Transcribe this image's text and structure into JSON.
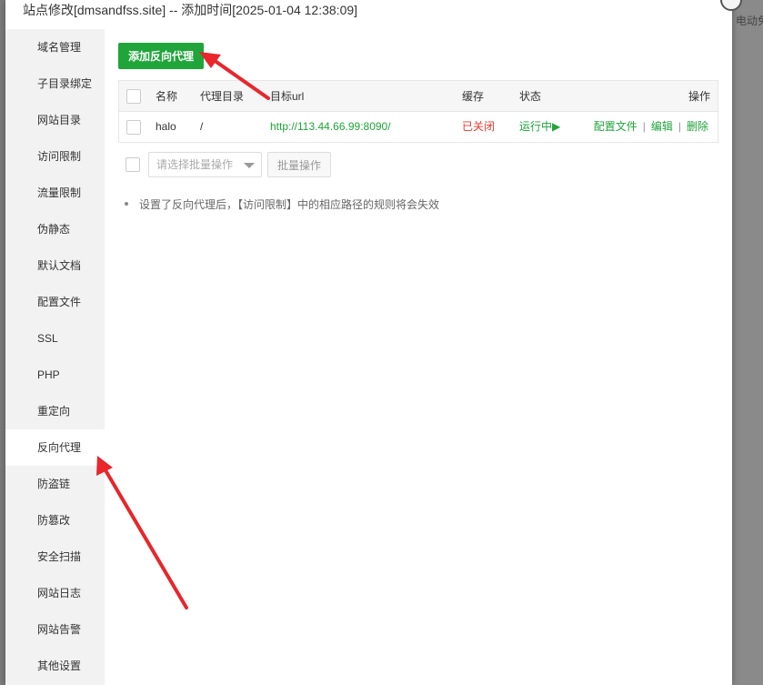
{
  "window": {
    "title": "站点修改[dmsandfss.site] -- 添加时间[2025-01-04 12:38:09]"
  },
  "background": {
    "right_label": "电动免"
  },
  "sidebar": {
    "items": [
      {
        "label": "域名管理"
      },
      {
        "label": "子目录绑定"
      },
      {
        "label": "网站目录"
      },
      {
        "label": "访问限制"
      },
      {
        "label": "流量限制"
      },
      {
        "label": "伪静态"
      },
      {
        "label": "默认文档"
      },
      {
        "label": "配置文件"
      },
      {
        "label": "SSL"
      },
      {
        "label": "PHP"
      },
      {
        "label": "重定向"
      },
      {
        "label": "反向代理",
        "active": true
      },
      {
        "label": "防盗链"
      },
      {
        "label": "防篡改"
      },
      {
        "label": "安全扫描"
      },
      {
        "label": "网站日志"
      },
      {
        "label": "网站告警"
      },
      {
        "label": "其他设置"
      }
    ]
  },
  "toolbar": {
    "add_proxy_label": "添加反向代理"
  },
  "table": {
    "headers": {
      "name": "名称",
      "proxy_dir": "代理目录",
      "target_url": "目标url",
      "cache": "缓存",
      "status": "状态",
      "actions": "操作"
    },
    "rows": [
      {
        "name": "halo",
        "proxy_dir": "/",
        "target_url": "http://113.44.66.99:8090/",
        "cache": "已关闭",
        "status": "运行中",
        "status_icon": "▶",
        "action_config": "配置文件",
        "action_edit": "编辑",
        "action_delete": "删除",
        "separator": "|"
      }
    ]
  },
  "batch": {
    "select_placeholder": "请选择批量操作",
    "button_label": "批量操作"
  },
  "tips": [
    "设置了反向代理后，【访问限制】中的相应路径的规则将会失效"
  ],
  "colors": {
    "accent": "#20a53a",
    "danger": "#e8382d",
    "annotation_arrow": "#e8262b"
  }
}
